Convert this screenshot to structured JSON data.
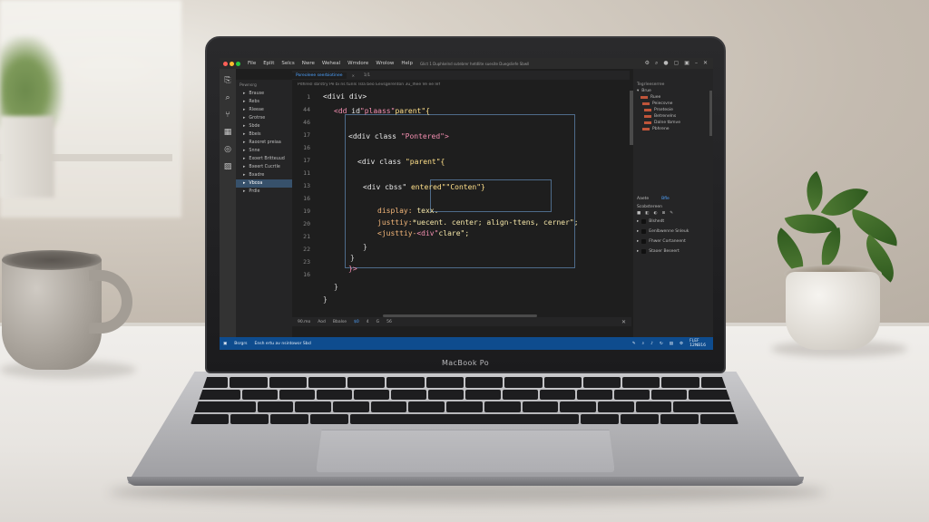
{
  "laptop": {
    "brand_label": "MacBook Po"
  },
  "ide": {
    "menu": [
      "File",
      "Eplit",
      "Selcs",
      "Nwre",
      "Weheal",
      "Wmdore",
      "Wrolow",
      "Help"
    ],
    "window_title": "Glict 1 Duphkelnd sutebrer hetdlite suesite Duegsliefe Sbwll",
    "tabs": [
      {
        "label": "Poreoleee seerbiotinee",
        "active": true
      },
      {
        "label": "1/1",
        "active": false
      }
    ],
    "breadcrumb": "Pdhresl sbrstry   Pe bi ns tunls  Tsla beo  Eevsgerenton  3u_lhee  Ve  ee  lef",
    "explorer": {
      "title": "Pewnsrg",
      "items": [
        {
          "label": "Brause",
          "active": false
        },
        {
          "label": "Rebs",
          "active": false
        },
        {
          "label": "Rleeae",
          "active": false
        },
        {
          "label": "Grotrse",
          "active": false
        },
        {
          "label": "Sbde",
          "active": false
        },
        {
          "label": "Bbeis",
          "active": false
        },
        {
          "label": "Raooret preiaa",
          "active": false
        },
        {
          "label": "Snne",
          "active": false
        },
        {
          "label": "Exoert Britteuud",
          "active": false
        },
        {
          "label": "Bxeert Cucrtle",
          "active": false
        },
        {
          "label": "Bxadre",
          "active": false
        },
        {
          "label": "Vbcoa",
          "active": true
        },
        {
          "label": "Prdle",
          "active": false
        }
      ]
    },
    "gutter": [
      "1",
      "44",
      "46",
      "17",
      "16",
      "17",
      "11",
      "13",
      "16",
      "19",
      "20",
      "21",
      "22",
      "23",
      "16"
    ],
    "code": {
      "l1": "<divi div>",
      "l2a": "<dd",
      "l2b": " id",
      "l2c": "\"plaass\"",
      "l2d": "parent\"{",
      "l3a": "<ddiv",
      "l3b": " class",
      "l3c": " \"Pontered\">",
      "l4a": "<div",
      "l4b": " class",
      "l4c": " \"parent\"{",
      "l5a": "<div",
      "l5b": " cbss\"",
      "l5c": "  entered\"\"Conten\"}",
      "l6a": "display:",
      "l6b": " texx.",
      "l7a": "justtiy:",
      "l7b": "*uecent. center;",
      "l7c": " align-ttens,",
      "l7d": " cerner\";",
      "l8a": "<justtiy-",
      "l8b": "<div\"",
      "l8c": "clare\";",
      "l9": "}",
      "l10": "}",
      "l11": "}>",
      "l12": "}",
      "l13": "}"
    },
    "panel_tabs": [
      "90.mo",
      "Aod",
      "Bbalse",
      "$0",
      "4",
      "G",
      "56"
    ],
    "right_panel": {
      "title": "Tegrleeserree",
      "rows": [
        "Brue",
        "Ruee",
        "Peiecsvne",
        "Prseteoie",
        "Betrenelns",
        "Dalne tbmve",
        "Pbhrene"
      ],
      "tabs": [
        "Aaete",
        "Bfle"
      ],
      "section": "Scobstereen",
      "props": [
        "Blshedt",
        "Eenlbwenne Snleuk",
        "Fhwer Cortaneent",
        "Staoer Beseert"
      ]
    },
    "status": {
      "left": "Bsrgrs",
      "center": "Ensh ertu av nsintowor Sbcl",
      "right_top": "FLEF",
      "right_bottom": "12NB16"
    }
  },
  "colors": {
    "statusbar": "#0e4c8e",
    "editor_bg": "#1e1e1e",
    "accent": "#4fa3ff"
  }
}
